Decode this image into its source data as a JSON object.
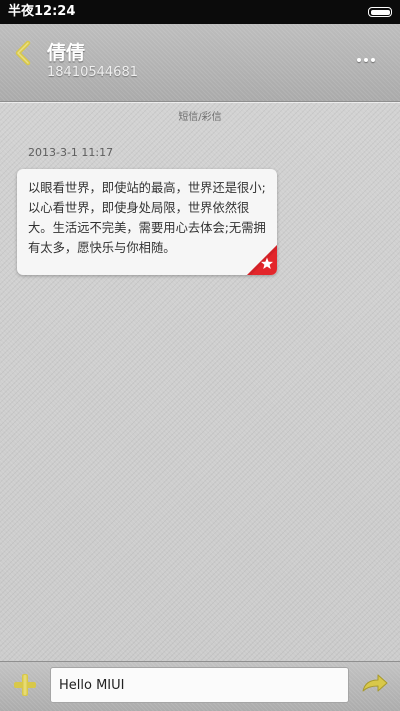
{
  "status_bar": {
    "time": "半夜12:24",
    "icons": {
      "battery": "battery-icon"
    }
  },
  "header": {
    "contact_name": "倩倩",
    "contact_number": "18410544681",
    "icons": {
      "back": "back-arrow-icon",
      "more": "more-dots-icon"
    }
  },
  "conversation": {
    "message_type_label": "短信/彩信",
    "messages": [
      {
        "timestamp": "2013-3-1 11:17",
        "text": "以眼看世界，即使站的最高，世界还是很小;以心看世界，即使身处局限，世界依然很大。生活远不完美，需要用心去体会;无需拥有太多，愿快乐与你相随。",
        "starred": true
      }
    ]
  },
  "input_bar": {
    "input_value": "Hello MIUI",
    "icons": {
      "add": "plus-icon",
      "send": "send-arrow-icon"
    }
  },
  "colors": {
    "status_bar": "#0b0b0b",
    "header": "#b5b5b5",
    "background": "#cfcfcf",
    "bubble": "#f6f6f6",
    "accent_yellow": "#d8c84a",
    "star_badge": "#e3262b"
  }
}
